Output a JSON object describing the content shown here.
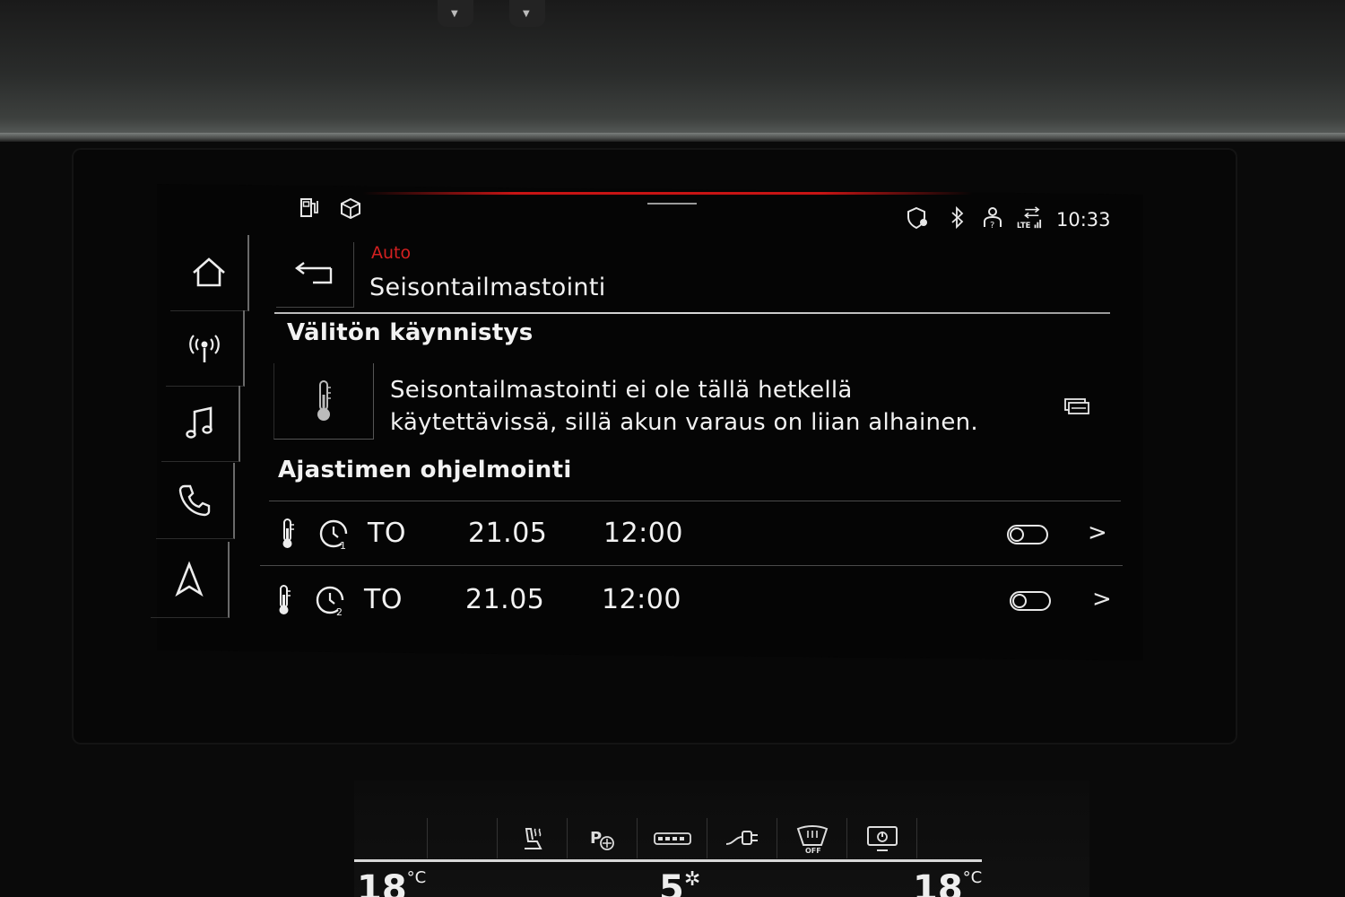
{
  "status": {
    "time": "10:33",
    "icons": [
      "fuel-station-icon",
      "cube-icon",
      "location-shield-icon",
      "bluetooth-icon",
      "profile-icon",
      "lte-signal-icon"
    ]
  },
  "sidebar": {
    "items": [
      {
        "name": "home",
        "icon": "home-icon"
      },
      {
        "name": "radio",
        "icon": "radio-antenna-icon"
      },
      {
        "name": "media",
        "icon": "music-note-icon"
      },
      {
        "name": "phone",
        "icon": "phone-icon"
      },
      {
        "name": "navigation",
        "icon": "navigation-arrow-icon"
      }
    ]
  },
  "header": {
    "breadcrumb": "Auto",
    "title": "Seisontailmastointi"
  },
  "instant_start": {
    "title": "Välitön käynnistys",
    "message_line1": "Seisontailmastointi ei ole tällä hetkellä",
    "message_line2": "käytettävissä, sillä akun varaus on liian alhainen."
  },
  "timer_programming": {
    "title": "Ajastimen ohjelmointi",
    "timers": [
      {
        "day": "TO",
        "date": "21.05",
        "time": "12:00",
        "timer_number": "1",
        "enabled": false
      },
      {
        "day": "TO",
        "date": "21.05",
        "time": "12:00",
        "timer_number": "2",
        "enabled": false
      }
    ]
  },
  "climate_panel": {
    "left_temp": "18",
    "fan_level": "5",
    "right_temp": "18",
    "temp_unit": "°C",
    "off_label": "OFF"
  },
  "colors": {
    "accent_red": "#d42020",
    "text": "#f2f2f2",
    "background": "#050505"
  }
}
